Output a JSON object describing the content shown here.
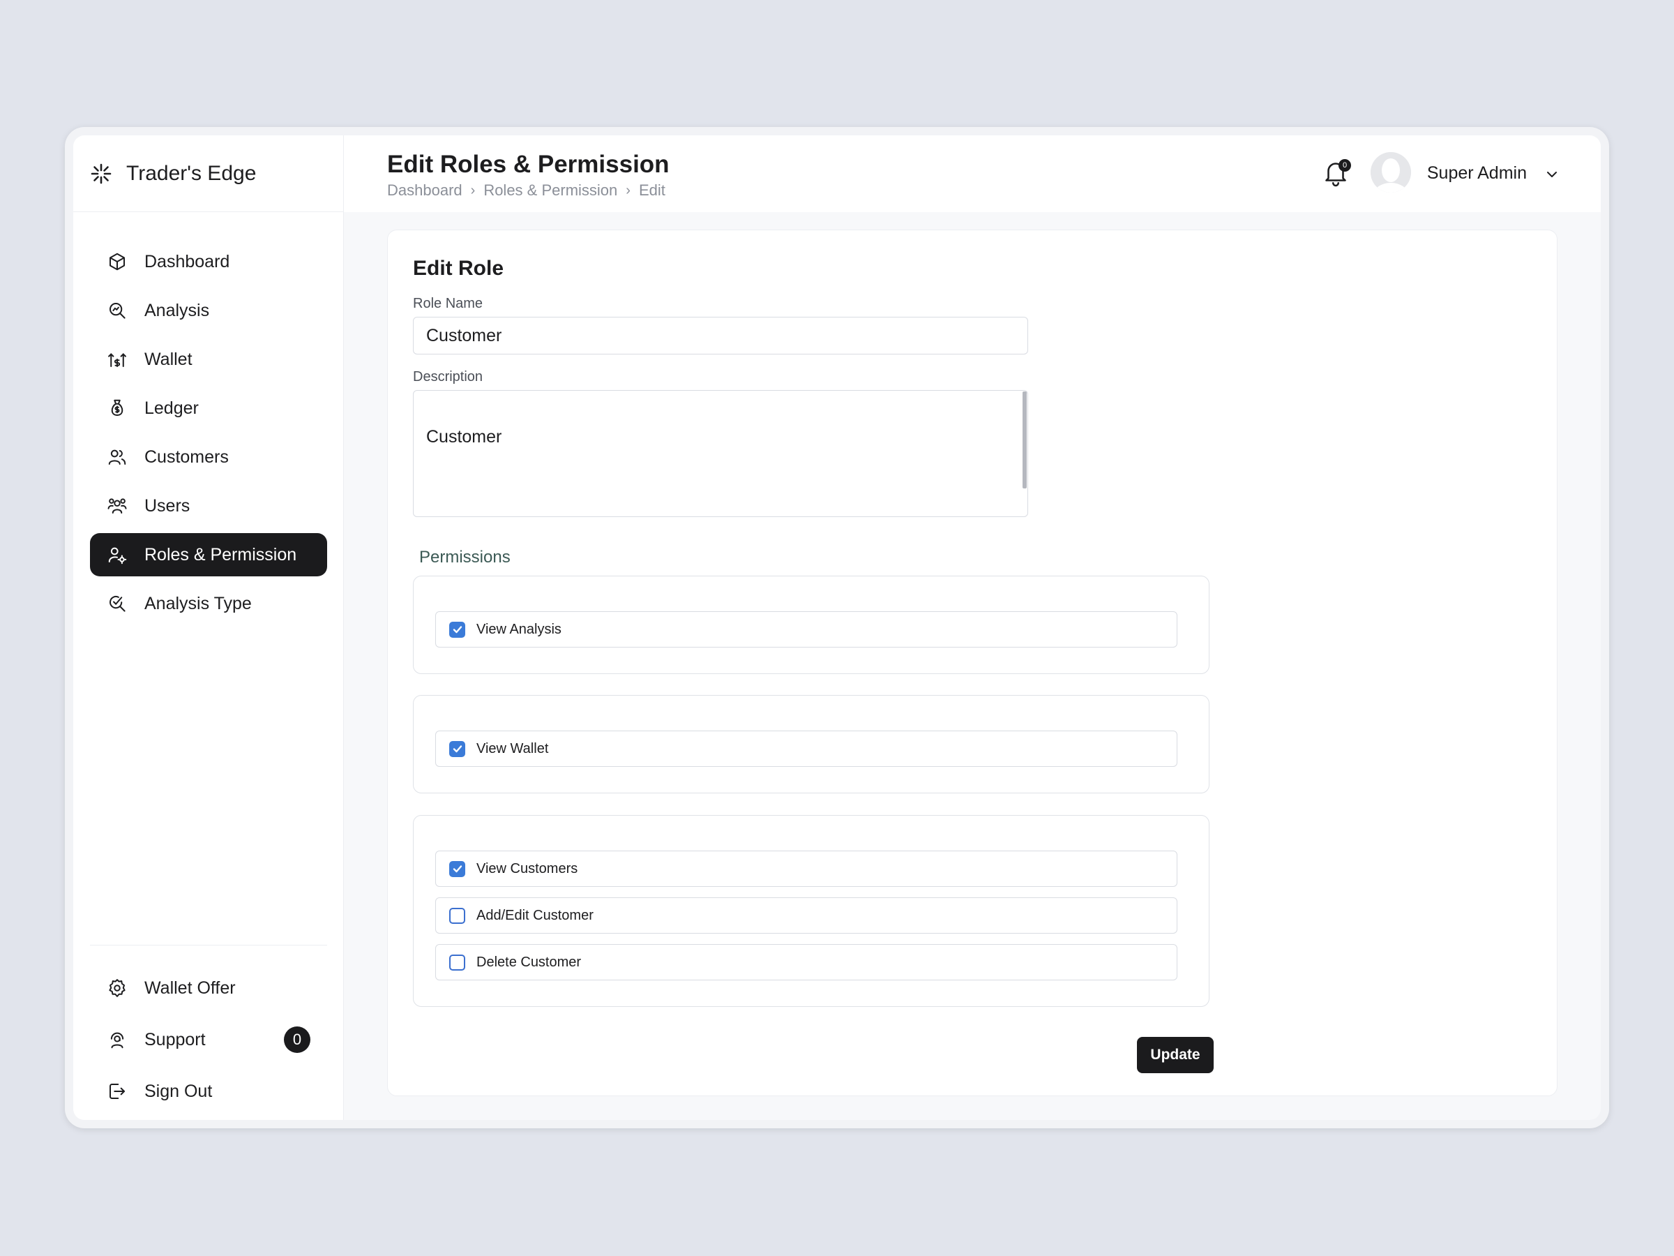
{
  "brand": {
    "name": "Trader's Edge"
  },
  "sidebar": {
    "items": [
      {
        "label": "Dashboard",
        "icon": "cube-icon"
      },
      {
        "label": "Analysis",
        "icon": "magnifier-chart-icon"
      },
      {
        "label": "Wallet",
        "icon": "wallet-arrows-icon"
      },
      {
        "label": "Ledger",
        "icon": "money-bag-icon"
      },
      {
        "label": "Customers",
        "icon": "customers-icon"
      },
      {
        "label": "Users",
        "icon": "users-icon"
      },
      {
        "label": "Roles & Permission",
        "icon": "user-gear-icon",
        "active": true
      },
      {
        "label": "Analysis Type",
        "icon": "search-check-icon"
      }
    ],
    "bottom_items": [
      {
        "label": "Wallet Offer",
        "icon": "gear-icon"
      },
      {
        "label": "Support",
        "icon": "support-icon",
        "badge": "0"
      },
      {
        "label": "Sign Out",
        "icon": "sign-out-icon"
      }
    ]
  },
  "header": {
    "title": "Edit Roles & Permission",
    "breadcrumb": [
      "Dashboard",
      "Roles & Permission",
      "Edit"
    ],
    "notification_count": "0",
    "user_name": "Super Admin"
  },
  "form": {
    "title": "Edit Role",
    "role_name_label": "Role Name",
    "role_name_value": "Customer",
    "description_label": "Description",
    "description_value": "Customer",
    "permissions_heading": "Permissions",
    "groups": [
      {
        "permissions": [
          {
            "label": "View Analysis",
            "checked": true
          }
        ]
      },
      {
        "permissions": [
          {
            "label": "View Wallet",
            "checked": true
          }
        ]
      },
      {
        "permissions": [
          {
            "label": "View Customers",
            "checked": true
          },
          {
            "label": "Add/Edit Customer",
            "checked": false
          },
          {
            "label": "Delete Customer",
            "checked": false
          }
        ]
      }
    ],
    "submit_label": "Update"
  },
  "colors": {
    "primary_dark": "#1b1b1d",
    "checkbox_blue": "#3b7bd8",
    "background": "#e1e4ec"
  }
}
